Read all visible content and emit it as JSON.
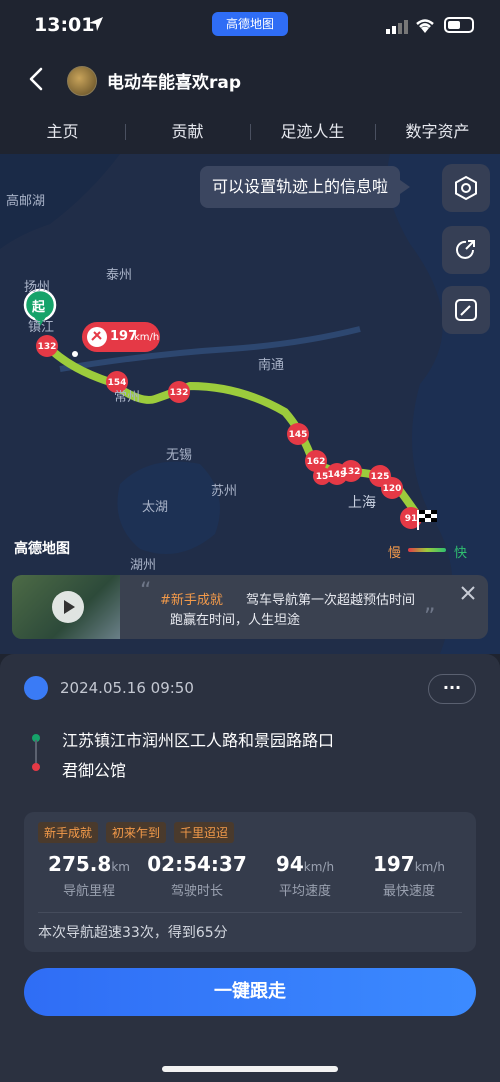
{
  "status": {
    "time": "13:01",
    "app_pill": "高德地图"
  },
  "header": {
    "title": "电动车能喜欢rap"
  },
  "tabs": [
    "主页",
    "贡献",
    "足迹人生",
    "数字资产"
  ],
  "map": {
    "labels": {
      "gaoyou": "高邮湖",
      "yangzhou": "扬州",
      "taizhou": "泰州",
      "zhenjiang": "镇江",
      "nantong": "南通",
      "changzhou": "常州",
      "wuxi": "无锡",
      "suzhou": "苏州",
      "taihu": "太湖",
      "huzhou": "湖州",
      "shanghai": "上海"
    },
    "start_badge": "起",
    "speed_callout": "197",
    "speed_unit": "km/h",
    "tooltip": "可以设置轨迹上的信息啦",
    "speed_markers": [
      "132",
      "154",
      "132",
      "145",
      "162",
      "149",
      "132",
      "125",
      "120",
      "91",
      "15"
    ],
    "legend": {
      "slow": "慢",
      "fast": "快"
    },
    "logo": "高德地图"
  },
  "banner": {
    "tag": "#新手成就",
    "line1": "驾车导航第一次超越预估时间",
    "line2": "跑赢在时间，人生坦途"
  },
  "trip": {
    "date": "2024.05.16 09:50",
    "from": "江苏镇江市润州区工人路和景园路路口",
    "to": "君御公馆",
    "badges": [
      "新手成就",
      "初来乍到",
      "千里迢迢"
    ],
    "stats": [
      {
        "value": "275.8",
        "unit": "km",
        "label": "导航里程"
      },
      {
        "value": "02:54:37",
        "unit": "",
        "label": "驾驶时长"
      },
      {
        "value": "94",
        "unit": "km/h",
        "label": "平均速度"
      },
      {
        "value": "197",
        "unit": "km/h",
        "label": "最快速度"
      }
    ],
    "summary": "本次导航超速33次，得到65分",
    "cta": "一键跟走"
  },
  "colors": {
    "accent": "#2f6df5",
    "route": "#9ccc3c",
    "speed_marker": "#e53946",
    "start": "#16a36a"
  }
}
